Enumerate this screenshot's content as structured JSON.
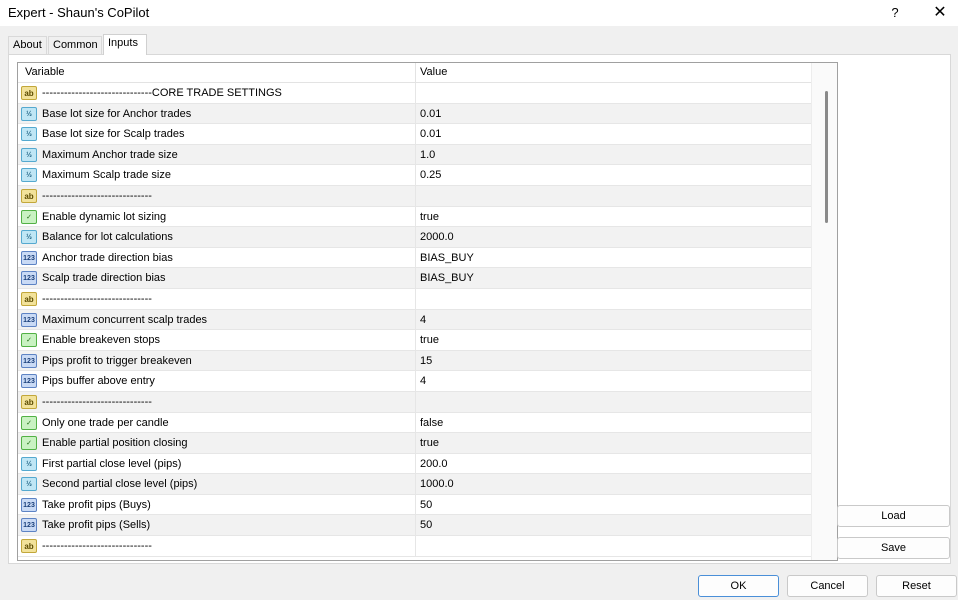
{
  "window": {
    "title": "Expert - Shaun's CoPilot",
    "help": "?",
    "close": "✕"
  },
  "tabs": [
    {
      "label": "About"
    },
    {
      "label": "Common"
    },
    {
      "label": "Inputs"
    }
  ],
  "table": {
    "headers": {
      "variable": "Variable",
      "value": "Value"
    },
    "rows": [
      {
        "icon": "ab",
        "name": "------------------------------CORE TRADE SETTINGS",
        "value": ""
      },
      {
        "icon": "½",
        "name": "Base lot size for Anchor trades",
        "value": "0.01"
      },
      {
        "icon": "½",
        "name": "Base lot size for Scalp trades",
        "value": "0.01"
      },
      {
        "icon": "½",
        "name": "Maximum Anchor trade size",
        "value": "1.0"
      },
      {
        "icon": "½",
        "name": "Maximum Scalp trade size",
        "value": "0.25"
      },
      {
        "icon": "ab",
        "name": "------------------------------",
        "value": ""
      },
      {
        "icon": "✓",
        "name": "Enable dynamic lot sizing",
        "value": "true"
      },
      {
        "icon": "½",
        "name": "Balance for lot calculations",
        "value": "2000.0"
      },
      {
        "icon": "123",
        "name": "Anchor trade direction bias",
        "value": "BIAS_BUY"
      },
      {
        "icon": "123",
        "name": "Scalp trade direction bias",
        "value": "BIAS_BUY"
      },
      {
        "icon": "ab",
        "name": "------------------------------",
        "value": ""
      },
      {
        "icon": "123",
        "name": "Maximum concurrent scalp trades",
        "value": "4"
      },
      {
        "icon": "✓",
        "name": "Enable breakeven stops",
        "value": "true"
      },
      {
        "icon": "123",
        "name": "Pips profit to trigger breakeven",
        "value": "15"
      },
      {
        "icon": "123",
        "name": "Pips buffer above entry",
        "value": "4"
      },
      {
        "icon": "ab",
        "name": "------------------------------",
        "value": ""
      },
      {
        "icon": "✓",
        "name": "Only one trade per candle",
        "value": "false"
      },
      {
        "icon": "✓",
        "name": "Enable partial position closing",
        "value": "true"
      },
      {
        "icon": "½",
        "name": "First partial close level (pips)",
        "value": "200.0"
      },
      {
        "icon": "½",
        "name": "Second partial close level (pips)",
        "value": "1000.0"
      },
      {
        "icon": "123",
        "name": "Take profit pips (Buys)",
        "value": "50"
      },
      {
        "icon": "123",
        "name": "Take profit pips (Sells)",
        "value": "50"
      },
      {
        "icon": "ab",
        "name": "------------------------------",
        "value": ""
      }
    ]
  },
  "buttons": {
    "load": "Load",
    "save": "Save",
    "ok": "OK",
    "cancel": "Cancel",
    "reset": "Reset"
  }
}
